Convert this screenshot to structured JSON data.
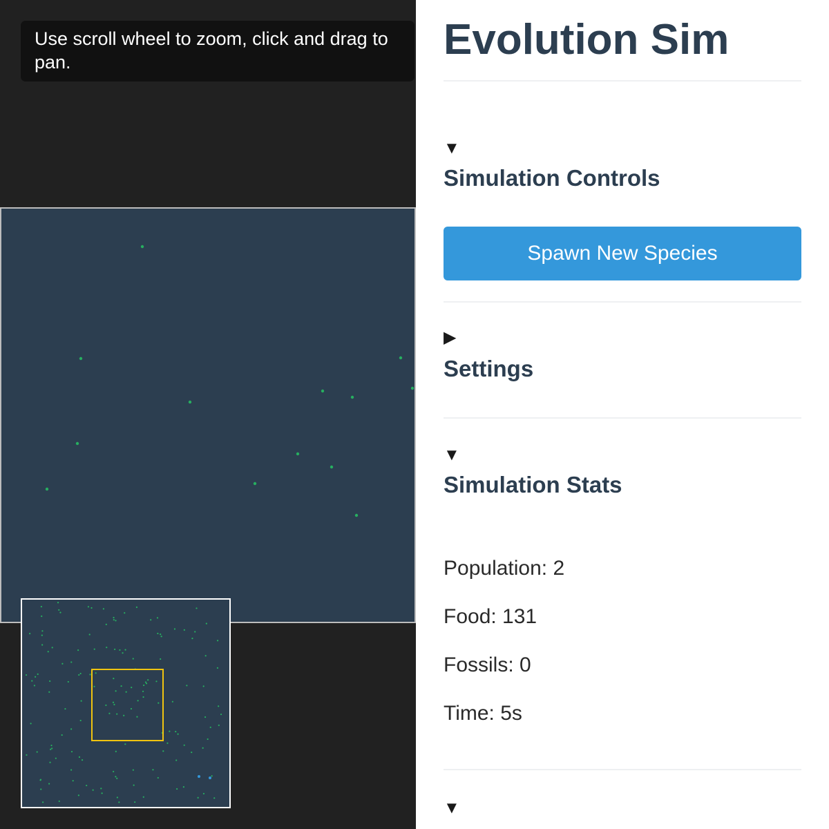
{
  "sim": {
    "hint": "Use scroll wheel to zoom, click and drag to pan.",
    "world_background": "#2c3e50",
    "minimap_viewport_color": "#f1c40f",
    "food_color": "#27ae60",
    "creature_color": "#3498db"
  },
  "panel": {
    "title": "Evolution Sim",
    "sections": {
      "controls": {
        "title": "Simulation Controls",
        "toggle_icon": "▼",
        "spawn_label": "Spawn New Species"
      },
      "settings": {
        "title": "Settings",
        "toggle_icon": "▶"
      },
      "stats": {
        "title": "Simulation Stats",
        "toggle_icon": "▼",
        "population": "Population: 2",
        "food": "Food: 131",
        "fossils": "Fossils: 0",
        "time": "Time: 5s"
      },
      "selected": {
        "toggle_icon": "▼"
      }
    },
    "accent_color": "#3498db"
  }
}
